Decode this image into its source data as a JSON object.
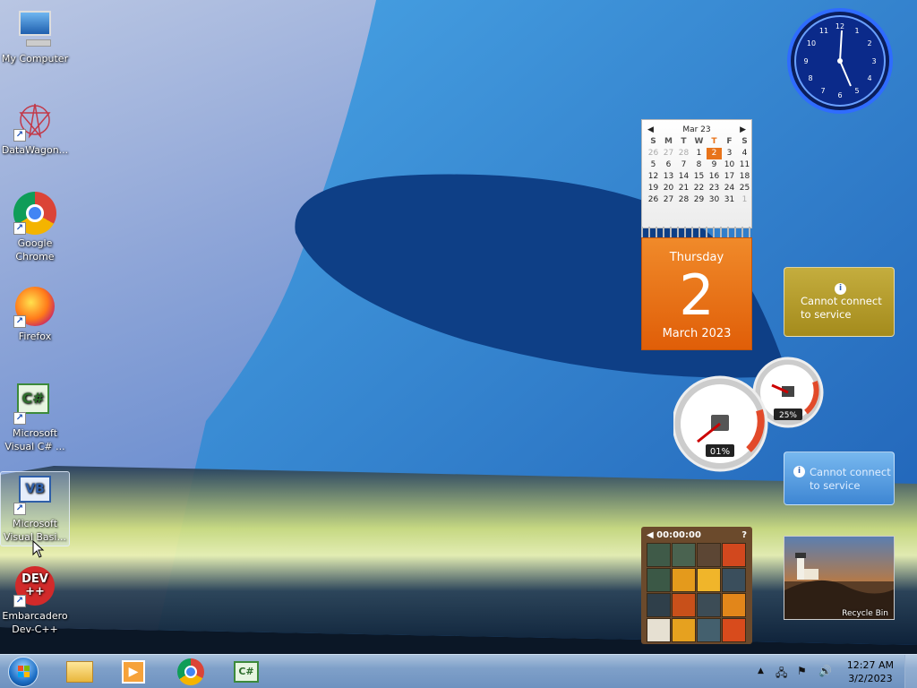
{
  "desktop": {
    "icons": [
      {
        "label": "My Computer",
        "icon": "computer-icon"
      },
      {
        "label": "DataWagon...",
        "icon": "datawagon-icon"
      },
      {
        "label": "Google Chrome",
        "icon": "chrome-icon"
      },
      {
        "label": "Firefox",
        "icon": "firefox-icon"
      },
      {
        "label": "Microsoft Visual C# ...",
        "icon": "visual-csharp-icon"
      },
      {
        "label": "Microsoft Visual Basi...",
        "icon": "visual-basic-icon"
      },
      {
        "label": "Embarcadero Dev-C++",
        "icon": "devcpp-icon"
      }
    ]
  },
  "gadgets": {
    "clock": {
      "time": "12:27"
    },
    "calendar": {
      "month_label": "Mar 23",
      "day_names": [
        "S",
        "M",
        "T",
        "W",
        "T",
        "F",
        "S"
      ],
      "days": [
        "26",
        "27",
        "28",
        "1",
        "2",
        "3",
        "4",
        "5",
        "6",
        "7",
        "8",
        "9",
        "10",
        "11",
        "12",
        "13",
        "14",
        "15",
        "16",
        "17",
        "18",
        "19",
        "20",
        "21",
        "22",
        "23",
        "24",
        "25",
        "26",
        "27",
        "28",
        "29",
        "30",
        "31",
        "1"
      ],
      "weekday": "Thursday",
      "day": "2",
      "month_year": "March 2023"
    },
    "weather": {
      "message": "Cannot connect to service"
    },
    "cpu_meter": {
      "cpu": "01%",
      "memory": "25%"
    },
    "feed": {
      "message": "Cannot connect to service"
    },
    "puzzle": {
      "timer": "00:00:00",
      "help": "?"
    },
    "slideshow": {
      "caption": "Recycle Bin"
    }
  },
  "taskbar": {
    "pinned": [
      "windows-explorer-icon",
      "media-player-icon",
      "chrome-icon",
      "visual-csharp-icon"
    ],
    "time": "12:27 AM",
    "date": "3/2/2023"
  },
  "colors": {
    "accent": "#e8731a",
    "taskbar": "#7fa0c9"
  }
}
